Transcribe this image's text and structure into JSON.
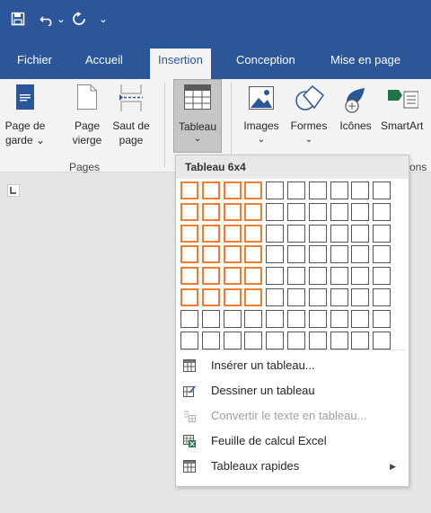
{
  "quick_access": {
    "save_icon": "save-icon",
    "undo_icon": "undo-icon",
    "undo_dropdown": "⌄",
    "redo_icon": "redo-icon",
    "customize": "⌄"
  },
  "tabs": [
    "Fichier",
    "Accueil",
    "Insertion",
    "Conception",
    "Mise en page"
  ],
  "active_tab": "Insertion",
  "ribbon": {
    "pages": {
      "page_de_garde": [
        "Page de",
        "garde ⌄"
      ],
      "page_vierge": [
        "Page",
        "vierge"
      ],
      "saut_de_page": [
        "Saut de",
        "page"
      ],
      "group_label": "Pages"
    },
    "tableau": {
      "label": "Tableau",
      "arrow": "⌄"
    },
    "illustrations": {
      "images": "Images",
      "formes": "Formes",
      "icones": "Icônes",
      "smartart": "SmartArt",
      "group_label_partial": "ons"
    }
  },
  "dropdown": {
    "title": "Tableau 6x4",
    "grid": {
      "columns": 10,
      "rows": 8,
      "selected_columns": 4,
      "selected_rows": 6
    },
    "items": [
      {
        "label": "Insérer un tableau...",
        "icon": "table-grid-icon",
        "enabled": true
      },
      {
        "label": "Dessiner un tableau",
        "icon": "draw-table-icon",
        "enabled": true
      },
      {
        "label": "Convertir le texte en tableau...",
        "icon": "convert-text-icon",
        "enabled": false
      },
      {
        "label": "Feuille de calcul Excel",
        "icon": "excel-sheet-icon",
        "enabled": true
      },
      {
        "label": "Tableaux rapides",
        "icon": "quick-tables-icon",
        "enabled": true,
        "submenu": "▶"
      }
    ]
  },
  "colors": {
    "title_bar": "#2b579a",
    "selected_cell": "#ed7d31",
    "ribbon_bg": "#f3f3f3"
  }
}
